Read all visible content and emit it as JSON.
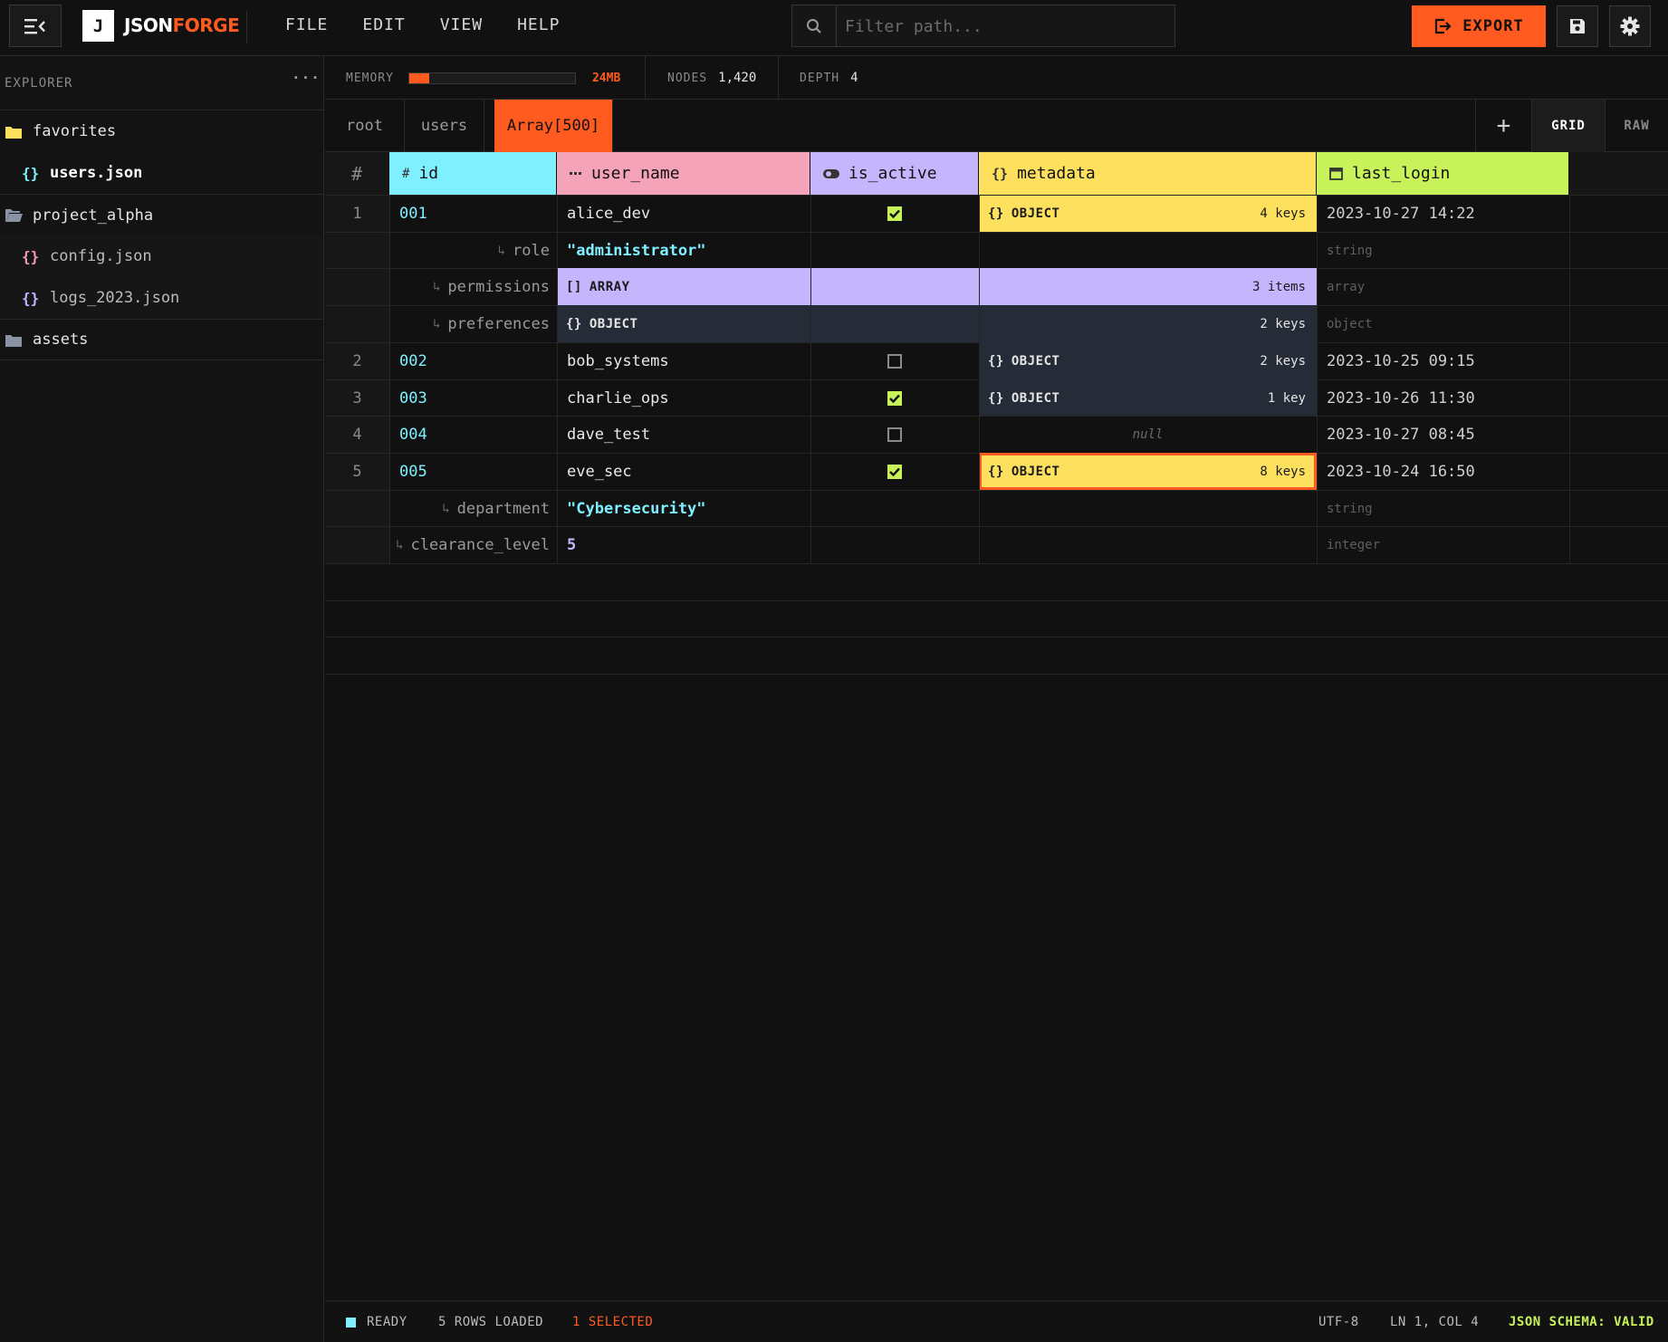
{
  "app": {
    "logo_letter": "J",
    "name_part1": "JSON",
    "name_part2": "FORGE",
    "accent_color": "#ff5a1f"
  },
  "nav": [
    "FILE",
    "EDIT",
    "VIEW",
    "HELP"
  ],
  "search": {
    "placeholder": "Filter path..."
  },
  "toolbar": {
    "export_label": "EXPORT",
    "save_icon": "save-icon",
    "settings_icon": "gear-icon"
  },
  "sidebar": {
    "title": "EXPLORER",
    "more": "···",
    "items": [
      {
        "label": "favorites",
        "type": "folder",
        "icon": "folder-icon",
        "color": "#fde15e"
      },
      {
        "label": "users.json",
        "type": "file",
        "icon": "json-file-icon",
        "color": "#7ff0ff",
        "active": true
      },
      {
        "label": "project_alpha",
        "type": "folder-open",
        "icon": "folder-open-icon",
        "color": "#8a93a6"
      },
      {
        "label": "config.json",
        "type": "file",
        "icon": "json-file-icon",
        "color": "#f49bb4"
      },
      {
        "label": "logs_2023.json",
        "type": "file",
        "icon": "json-file-icon",
        "color": "#c4b5fd"
      },
      {
        "label": "assets",
        "type": "folder",
        "icon": "folder-icon",
        "color": "#8a93a6"
      }
    ]
  },
  "stats": {
    "memory_label": "MEMORY",
    "memory_value": "24MB",
    "memory_fraction": 0.12,
    "nodes_label": "NODES",
    "nodes_value": "1,420",
    "depth_label": "DEPTH",
    "depth_value": "4"
  },
  "breadcrumb_tabs": [
    {
      "label": "root",
      "active": false
    },
    {
      "label": "users",
      "active": false
    },
    {
      "label": "Array[500]",
      "active": true
    }
  ],
  "view": {
    "add": "+",
    "grid": "GRID",
    "raw": "RAW",
    "selected": "GRID"
  },
  "grid": {
    "rownum_header": "#",
    "columns": [
      {
        "key": "id",
        "label": "id",
        "icon": "hash-icon",
        "color": "#7ff0ff"
      },
      {
        "key": "user_name",
        "label": "user_name",
        "icon": "text-icon",
        "color": "#f4a3b8"
      },
      {
        "key": "is_active",
        "label": "is_active",
        "icon": "toggle-icon",
        "color": "#c4b5fd"
      },
      {
        "key": "metadata",
        "label": "metadata",
        "icon": "braces-icon",
        "color": "#fde15e"
      },
      {
        "key": "last_login",
        "label": "last_login",
        "icon": "calendar-icon",
        "color": "#c8f25a"
      }
    ],
    "rows": [
      {
        "kind": "record",
        "num": "1",
        "id": "001",
        "user_name": "alice_dev",
        "is_active": true,
        "meta_type": "OBJECT",
        "meta_count": "4 keys",
        "meta_style": "yellow",
        "last_login": "2023-10-27 14:22"
      },
      {
        "kind": "child",
        "key": "role",
        "value": "\"administrator\"",
        "value_style": "string",
        "type": "string"
      },
      {
        "kind": "child",
        "key": "permissions",
        "block_type": "ARRAY",
        "block_count": "3 items",
        "block_style": "purple",
        "type": "array"
      },
      {
        "kind": "child",
        "key": "preferences",
        "block_type": "OBJECT",
        "block_count": "2 keys",
        "block_style": "slate",
        "type": "object"
      },
      {
        "kind": "record",
        "num": "2",
        "id": "002",
        "user_name": "bob_systems",
        "is_active": false,
        "meta_type": "OBJECT",
        "meta_count": "2 keys",
        "meta_style": "slate",
        "last_login": "2023-10-25 09:15"
      },
      {
        "kind": "record",
        "num": "3",
        "id": "003",
        "user_name": "charlie_ops",
        "is_active": true,
        "meta_type": "OBJECT",
        "meta_count": "1 key",
        "meta_style": "slate",
        "last_login": "2023-10-26 11:30"
      },
      {
        "kind": "record",
        "num": "4",
        "id": "004",
        "user_name": "dave_test",
        "is_active": false,
        "meta_null": "null",
        "last_login": "2023-10-27 08:45"
      },
      {
        "kind": "record",
        "num": "5",
        "id": "005",
        "user_name": "eve_sec",
        "is_active": true,
        "meta_type": "OBJECT",
        "meta_count": "8 keys",
        "meta_style": "yellow",
        "meta_selected": true,
        "last_login": "2023-10-24 16:50"
      },
      {
        "kind": "child",
        "key": "department",
        "value": "\"Cybersecurity\"",
        "value_style": "string",
        "type": "string"
      },
      {
        "kind": "child",
        "key": "clearance_level",
        "value": "5",
        "value_style": "number",
        "type": "integer"
      }
    ]
  },
  "status": {
    "ready": "READY",
    "rows_loaded": "5 ROWS LOADED",
    "selected": "1 SELECTED",
    "encoding": "UTF-8",
    "cursor": "LN 1, COL 4",
    "schema": "JSON SCHEMA: VALID"
  }
}
